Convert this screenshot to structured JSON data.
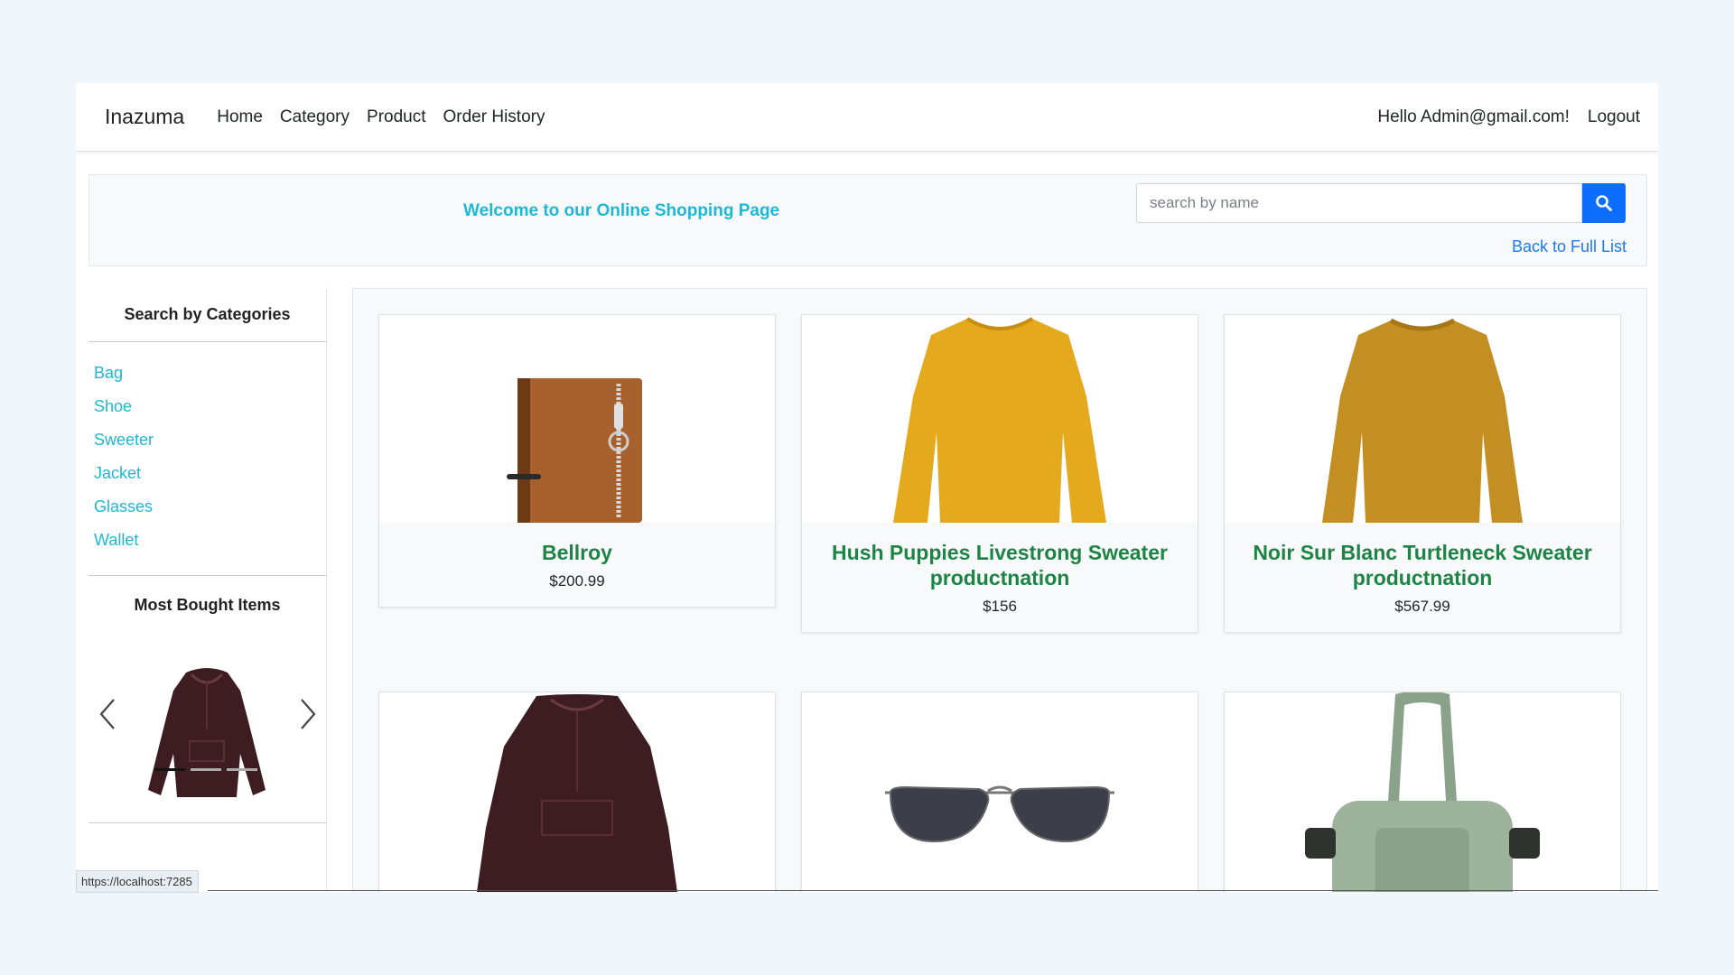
{
  "nav": {
    "brand": "Inazuma",
    "links": [
      "Home",
      "Category",
      "Product",
      "Order History"
    ],
    "greeting": "Hello Admin@gmail.com!",
    "logout": "Logout"
  },
  "welcome": {
    "text": "Welcome to our Online Shopping Page",
    "search_placeholder": "search by name",
    "search_icon": "search-icon",
    "back_link": "Back to Full List"
  },
  "sidebar": {
    "categories_title": "Search by Categories",
    "categories": [
      "Bag",
      "Shoe",
      "Sweeter",
      "Jacket",
      "Glasses",
      "Wallet"
    ],
    "most_bought_title": "Most Bought Items",
    "carousel": {
      "item_image": "hoodie-image",
      "slide_count": 3,
      "active_slide": 1
    }
  },
  "products": [
    {
      "name": "Bellroy",
      "price": "$200.99",
      "image": "wallet-image"
    },
    {
      "name": "Hush Puppies Livestrong Sweater productnation",
      "price": "$156",
      "image": "sweater-image"
    },
    {
      "name": "Noir Sur Blanc Turtleneck Sweater productnation",
      "price": "$567.99",
      "image": "sweater-image"
    },
    {
      "name": "",
      "price": "",
      "image": "hoodie-image"
    },
    {
      "name": "",
      "price": "",
      "image": "sunglasses-image"
    },
    {
      "name": "",
      "price": "",
      "image": "duffel-bag-image"
    }
  ],
  "status_bar": {
    "url": "https://localhost:7285"
  },
  "colors": {
    "accent_cyan": "#1eb8d6",
    "link_blue": "#1d7af2",
    "button_blue": "#0d6efd",
    "product_green": "#1d8445"
  }
}
